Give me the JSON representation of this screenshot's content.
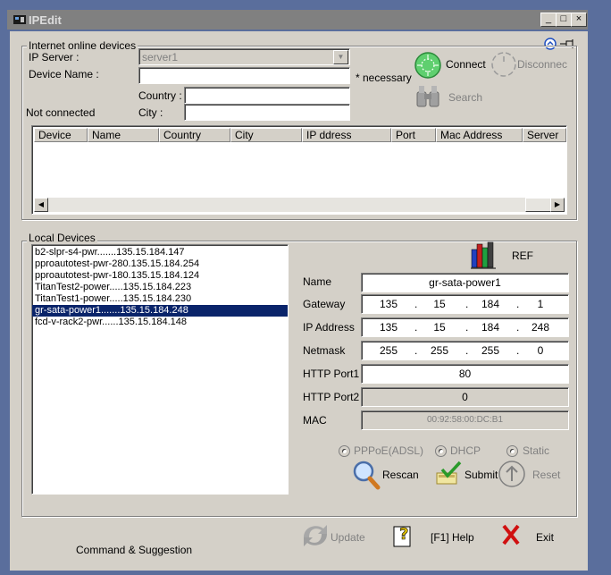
{
  "window": {
    "title": "IPEdit",
    "min": "_",
    "max": "□",
    "close": "×"
  },
  "online": {
    "group_label": "Internet online devices",
    "ip_server_label": "IP Server :",
    "ip_server_value": "server1",
    "device_name_label": "Device Name :",
    "device_name_value": "",
    "necessary_label": "* necessary",
    "country_label": "Country :",
    "city_label": "City :",
    "status": "Not connected",
    "connect_label": "Connect",
    "disconnect_label": "Disconnec",
    "search_label": "Search",
    "columns": [
      "Device",
      "Name",
      "Country",
      "City",
      "IP ddress",
      "Port",
      "Mac Address",
      "Server"
    ]
  },
  "local": {
    "group_label": "Local Devices",
    "devices": [
      "b2-slpr-s4-pwr.......135.15.184.147",
      "pproautotest-pwr-280.135.15.184.254",
      "pproautotest-pwr-180.135.15.184.124",
      "TitanTest2-power.....135.15.184.223",
      "TitanTest1-power.....135.15.184.230",
      "gr-sata-power1.......135.15.184.248",
      "fcd-v-rack2-pwr......135.15.184.148"
    ],
    "selected_index": 5,
    "ref_label": "REF",
    "name_label": "Name",
    "name_value": "gr-sata-power1",
    "gateway_label": "Gateway",
    "gateway": [
      "135",
      "15",
      "184",
      "1"
    ],
    "ip_label": "IP Address",
    "ip": [
      "135",
      "15",
      "184",
      "248"
    ],
    "netmask_label": "Netmask",
    "netmask": [
      "255",
      "255",
      "255",
      "0"
    ],
    "http1_label": "HTTP Port1",
    "http1_value": "80",
    "http2_label": "HTTP Port2",
    "http2_value": "0",
    "mac_label": "MAC",
    "mac_value": "00:92:58:00:DC:B1",
    "pppoe_label": "PPPoE(ADSL)",
    "dhcp_label": "DHCP",
    "static_label": "Static",
    "rescan_label": "Rescan",
    "submit_label": "Submit",
    "reset_label": "Reset"
  },
  "footer": {
    "suggestion_label": "Command & Suggestion",
    "update_label": "Update",
    "help_label": "[F1] Help",
    "exit_label": "Exit"
  },
  "colors": {
    "selection": "#0a246a",
    "face": "#d4d0c8",
    "desktop": "#5a6e9c"
  }
}
